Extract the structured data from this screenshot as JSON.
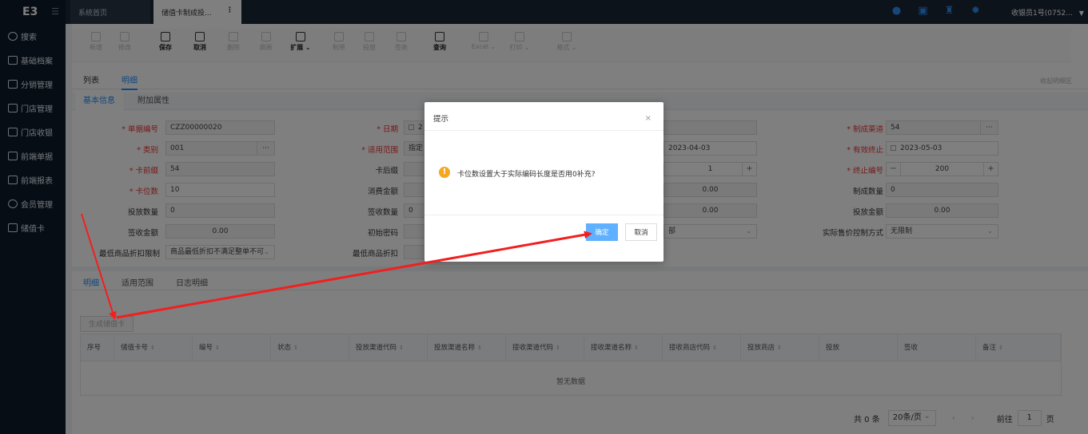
{
  "app": {
    "logo": "E3"
  },
  "sidebar": {
    "items": [
      {
        "label": "搜索",
        "icon": "search-icon"
      },
      {
        "label": "基础档案",
        "icon": "archive-icon"
      },
      {
        "label": "分销管理",
        "icon": "distribution-icon"
      },
      {
        "label": "门店管理",
        "icon": "store-icon"
      },
      {
        "label": "门店收银",
        "icon": "cashier-icon"
      },
      {
        "label": "前端单据",
        "icon": "document-icon"
      },
      {
        "label": "前端报表",
        "icon": "report-icon"
      },
      {
        "label": "会员管理",
        "icon": "member-icon"
      },
      {
        "label": "储值卡",
        "icon": "card-icon"
      }
    ]
  },
  "topbar": {
    "tabs": [
      {
        "label": "系统首页"
      },
      {
        "label": "储值卡制成投..."
      }
    ],
    "user": "收银员1号(0752..."
  },
  "toolbar": {
    "buttons": [
      {
        "label": "新增",
        "active": false
      },
      {
        "label": "修改",
        "active": false
      },
      {
        "label": "保存",
        "active": true
      },
      {
        "label": "取消",
        "active": true
      },
      {
        "label": "删除",
        "active": false
      },
      {
        "label": "刷新",
        "active": false
      },
      {
        "label": "扩展 ⌄",
        "active": true
      },
      {
        "label": "制单",
        "active": false
      },
      {
        "label": "投放",
        "active": false
      },
      {
        "label": "签收",
        "active": false
      },
      {
        "label": "查询",
        "active": true
      },
      {
        "label": "Excel ⌄",
        "active": false
      },
      {
        "label": "打印 ⌄",
        "active": false
      },
      {
        "label": "格式 ⌄",
        "active": false
      }
    ]
  },
  "subtabs": {
    "list": "列表",
    "detail": "明细",
    "collapse": "收起明细区"
  },
  "infotabs": {
    "basic": "基本信息",
    "extra": "附加属性"
  },
  "form": {
    "doc_no_label": "单据编号",
    "doc_no": "CZZ00000020",
    "date_label": "日期",
    "date_value": "2",
    "channel_label": "制成渠道",
    "channel": "54",
    "type_label": "类别",
    "type": "001",
    "scope_label": "适用范围",
    "scope": "指定",
    "valid_start": "2023-04-03",
    "valid_end_label": "有效终止",
    "valid_end": "2023-05-03",
    "prefix_label": "卡前缀",
    "prefix": "54",
    "suffix_label": "卡后缀",
    "start_no": "1",
    "end_no_label": "终止编号",
    "end_no": "200",
    "digits_label": "卡位数",
    "digits": "10",
    "consume_label": "消费金额",
    "amount_mid": "0.00",
    "made_qty_label": "制成数量",
    "made_qty": "0",
    "issue_qty_label": "投放数量",
    "issue_qty": "0",
    "sign_qty_label": "签收数量",
    "sign_qty": "0",
    "amount_mid2": "0.00",
    "issue_amount_label": "投放金额",
    "issue_amount": "0.00",
    "sign_amount_label": "签收金额",
    "sign_amount": "0.00",
    "init_pwd_label": "初始密码",
    "mid_select": "部",
    "price_ctrl_label": "实际售价控制方式",
    "price_ctrl": "无限制",
    "min_discount_limit_label": "最低商品折扣限制",
    "min_discount_limit": "商品最低折扣不满足整单不可",
    "min_discount_label": "最低商品折扣"
  },
  "detail": {
    "tabs": [
      "明细",
      "适用范围",
      "日志明细"
    ],
    "generate_button": "生成储值卡",
    "columns": [
      "序号",
      "储值卡号",
      "编号",
      "状态",
      "投放渠道代码",
      "投放渠道名称",
      "接收渠道代码",
      "接收渠道名称",
      "接收商店代码",
      "投放商店",
      "投放",
      "签收",
      "备注"
    ],
    "empty": "暂无数据"
  },
  "pager": {
    "total": "共 0 条",
    "page_size": "20条/页",
    "goto": "前往",
    "page": "1",
    "page_unit": "页"
  },
  "modal": {
    "title": "提示",
    "message": "卡位数设置大于实际编码长度是否用0补充?",
    "ok": "确定",
    "cancel": "取消"
  }
}
